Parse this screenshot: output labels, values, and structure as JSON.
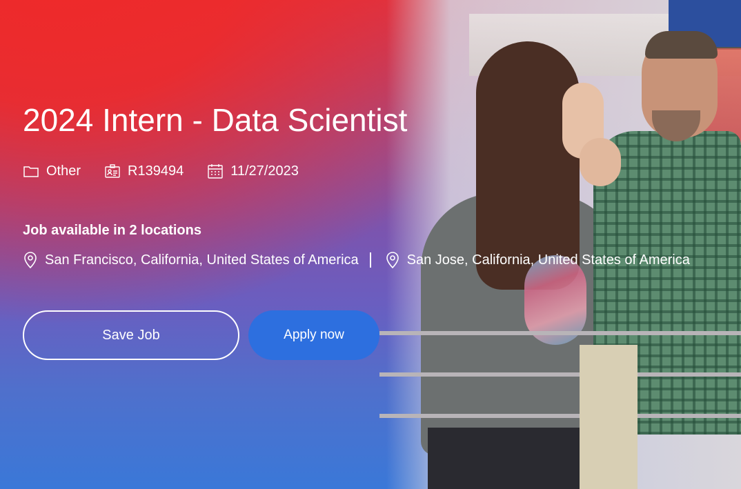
{
  "job": {
    "title": "2024 Intern - Data Scientist",
    "category": "Other",
    "requisition_id": "R139494",
    "posted_date": "11/27/2023"
  },
  "locations": {
    "heading": "Job available in 2 locations",
    "items": [
      "San Francisco, California, United States of America",
      "San Jose, California, United States of America"
    ]
  },
  "actions": {
    "save_label": "Save Job",
    "apply_label": "Apply now"
  },
  "icons": {
    "category": "folder-icon",
    "requisition": "id-badge-icon",
    "date": "calendar-icon",
    "location": "map-pin-icon"
  },
  "colors": {
    "gradient_top": "#ee2a2a",
    "gradient_mid": "#7a55b0",
    "gradient_bottom": "#3a78d8",
    "apply_button": "#2d6fdf",
    "text": "#ffffff"
  }
}
